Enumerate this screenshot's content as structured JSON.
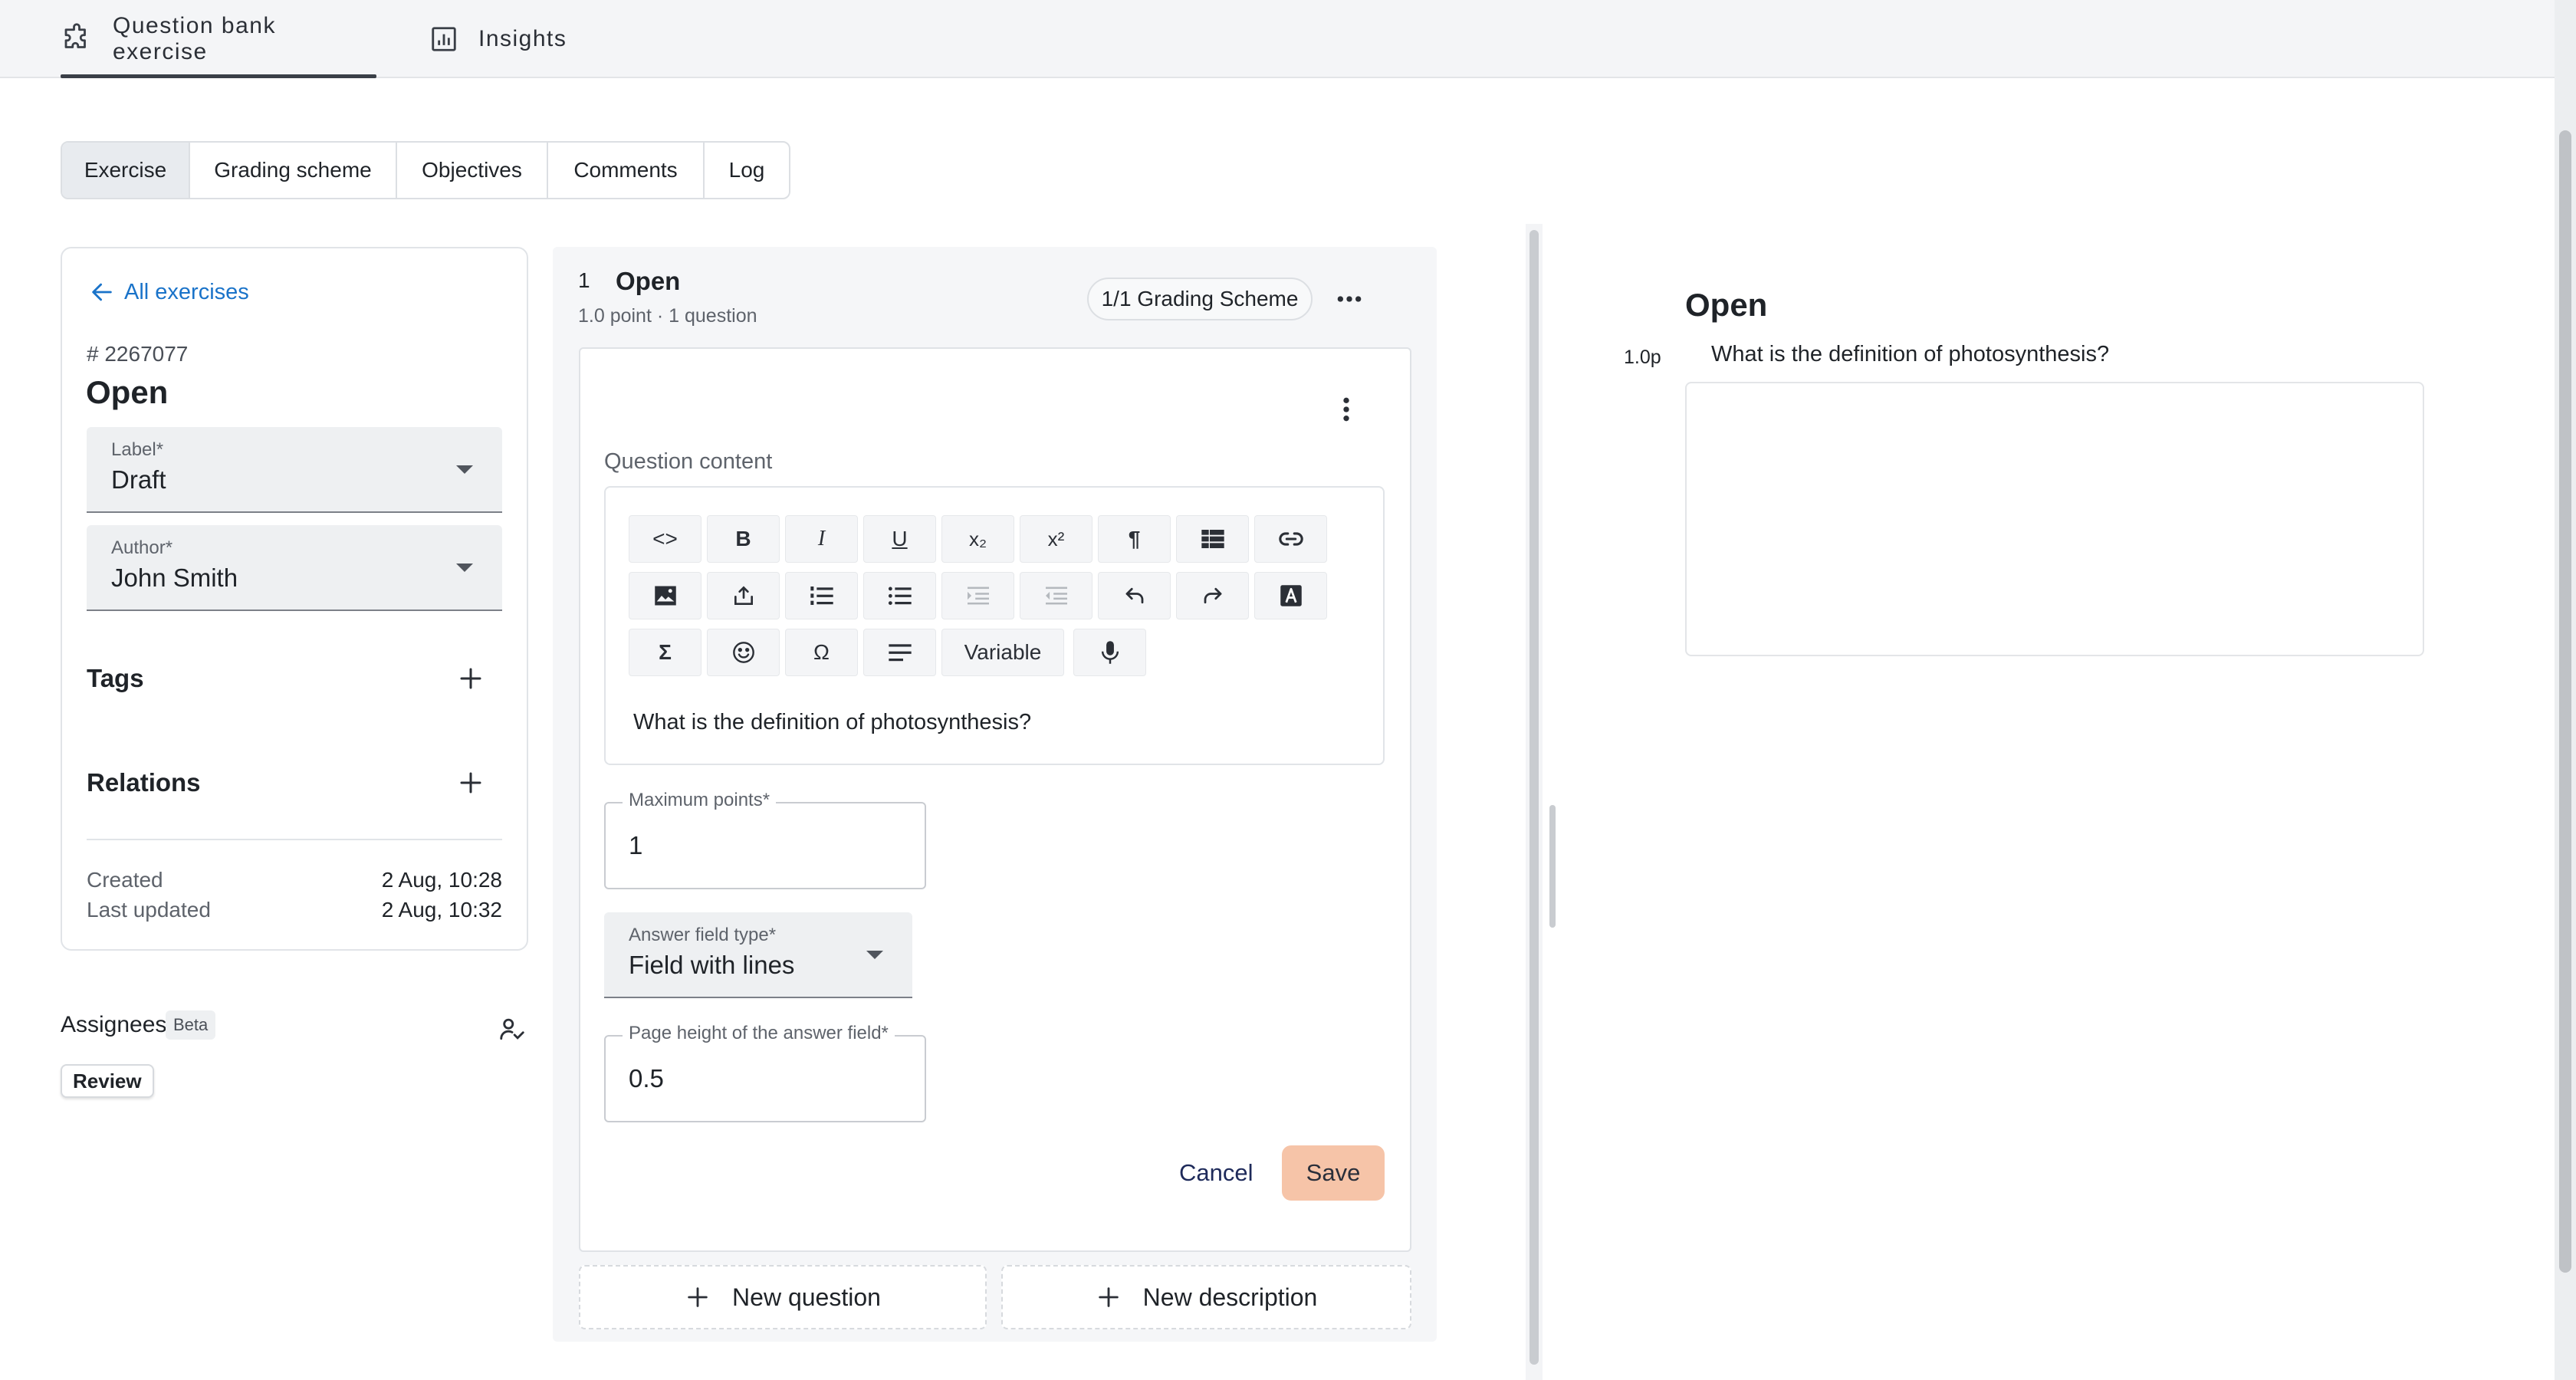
{
  "top_tabs": [
    {
      "label": "Question bank exercise",
      "icon": "puzzle-icon",
      "active": true
    },
    {
      "label": "Insights",
      "icon": "bar-chart-icon",
      "active": false
    }
  ],
  "sub_tabs": [
    {
      "label": "Exercise",
      "active": true
    },
    {
      "label": "Grading scheme",
      "active": false
    },
    {
      "label": "Objectives",
      "active": false
    },
    {
      "label": "Comments",
      "active": false
    },
    {
      "label": "Log",
      "active": false
    }
  ],
  "sidebar": {
    "back_label": "All exercises",
    "exercise_id": "# 2267077",
    "exercise_title": "Open",
    "label_field": {
      "label": "Label*",
      "value": "Draft"
    },
    "author_field": {
      "label": "Author*",
      "value": "John Smith"
    },
    "tags_title": "Tags",
    "relations_title": "Relations",
    "created_label": "Created",
    "created_value": "2 Aug, 10:28",
    "updated_label": "Last updated",
    "updated_value": "2 Aug, 10:32",
    "assignees_label": "Assignees",
    "beta_badge": "Beta",
    "review_chip": "Review"
  },
  "question": {
    "number": "1",
    "title": "Open",
    "subtitle": "1.0 point · 1 question",
    "grading_chip": "1/1 Grading Scheme",
    "content_label": "Question content",
    "toolbar": {
      "superscript_label": "x²",
      "subscript_label": "x₂",
      "bold_label": "B",
      "italic_label": "I",
      "underline_label": "U",
      "code_label": "<>",
      "pilcrow_label": "¶",
      "sigma_label": "Σ",
      "omega_label": "Ω",
      "variable_label": "Variable"
    },
    "content_text": "What is the definition of photosynthesis?",
    "max_points": {
      "label": "Maximum points*",
      "value": "1"
    },
    "answer_type": {
      "label": "Answer field type*",
      "value": "Field with lines"
    },
    "page_height": {
      "label": "Page height of the answer field*",
      "value": "0.5"
    },
    "cancel_label": "Cancel",
    "save_label": "Save",
    "new_question_label": "New question",
    "new_description_label": "New description"
  },
  "preview": {
    "title": "Open",
    "points": "1.0p",
    "question_text": "What is the definition of photosynthesis?"
  },
  "colors": {
    "link_blue": "#1a73c9",
    "save_button": "#f6c4a8",
    "panel_gray": "#f5f6f8"
  }
}
